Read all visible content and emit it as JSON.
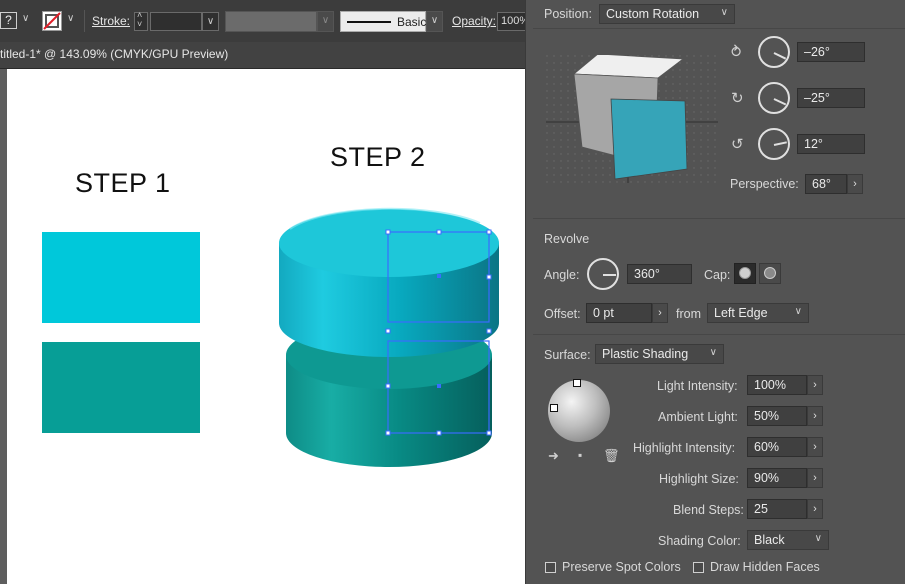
{
  "control_bar": {
    "help_glyph": "?",
    "stroke_label": "Stroke:",
    "brush_label": "Basic",
    "opacity_label": "Opacity:",
    "opacity_value": "100%"
  },
  "document": {
    "tab_title": "titled-1* @ 143.09% (CMYK/GPU Preview)"
  },
  "artboard": {
    "step1_label": "STEP 1",
    "step2_label": "STEP 2",
    "colors": {
      "cyan": "#00c8da",
      "teal": "#079e96"
    }
  },
  "panel": {
    "position": {
      "label": "Position:",
      "value": "Custom Rotation"
    },
    "rotation": {
      "x": "–26°",
      "y": "–25°",
      "z": "12°"
    },
    "perspective": {
      "label": "Perspective:",
      "value": "68°"
    },
    "revolve": {
      "heading": "Revolve",
      "angle_label": "Angle:",
      "angle_value": "360°",
      "cap_label": "Cap:",
      "offset_label": "Offset:",
      "offset_value": "0 pt",
      "from_label": "from",
      "from_value": "Left Edge"
    },
    "surface": {
      "label": "Surface:",
      "value": "Plastic Shading",
      "light_intensity_label": "Light Intensity:",
      "light_intensity": "100%",
      "ambient_light_label": "Ambient Light:",
      "ambient_light": "50%",
      "highlight_intensity_label": "Highlight Intensity:",
      "highlight_intensity": "60%",
      "highlight_size_label": "Highlight Size:",
      "highlight_size": "90%",
      "blend_steps_label": "Blend Steps:",
      "blend_steps": "25",
      "shading_color_label": "Shading Color:",
      "shading_color": "Black"
    },
    "preserve_spot_label": "Preserve Spot Colors",
    "draw_hidden_label": "Draw Hidden Faces"
  }
}
